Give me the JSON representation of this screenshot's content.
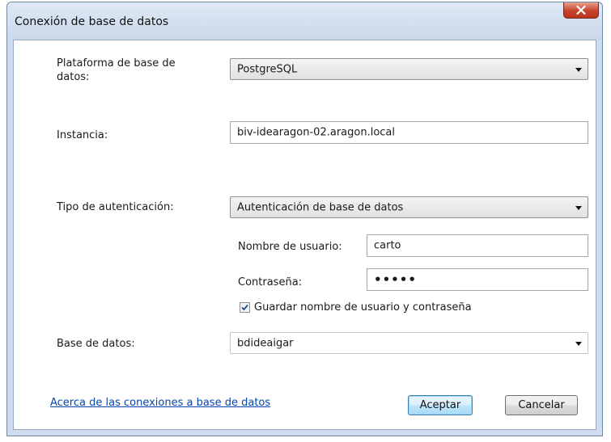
{
  "dialog": {
    "title": "Conexión de base de datos",
    "close_glyph": "close-icon"
  },
  "form": {
    "platform_label": "Plataforma de base de datos:",
    "platform_value": "PostgreSQL",
    "instance_label": "Instancia:",
    "instance_value": "biv-idearagon-02.aragon.local",
    "auth_label": "Tipo de autenticación:",
    "auth_value": "Autenticación de base de datos",
    "username_label": "Nombre de usuario:",
    "username_value": "carto",
    "password_label": "Contraseña:",
    "password_value": "•••••",
    "save_credentials_label": "Guardar nombre de usuario y contraseña",
    "save_credentials_checked": true,
    "database_label": "Base de datos:",
    "database_value": "bdideaigar"
  },
  "footer": {
    "help_link": "Acerca de las conexiones a base de datos",
    "ok_label": "Aceptar",
    "cancel_label": "Cancelar"
  },
  "colors": {
    "close_button": "#c7432a",
    "link": "#0645ad",
    "frame": "#cfdceb"
  }
}
